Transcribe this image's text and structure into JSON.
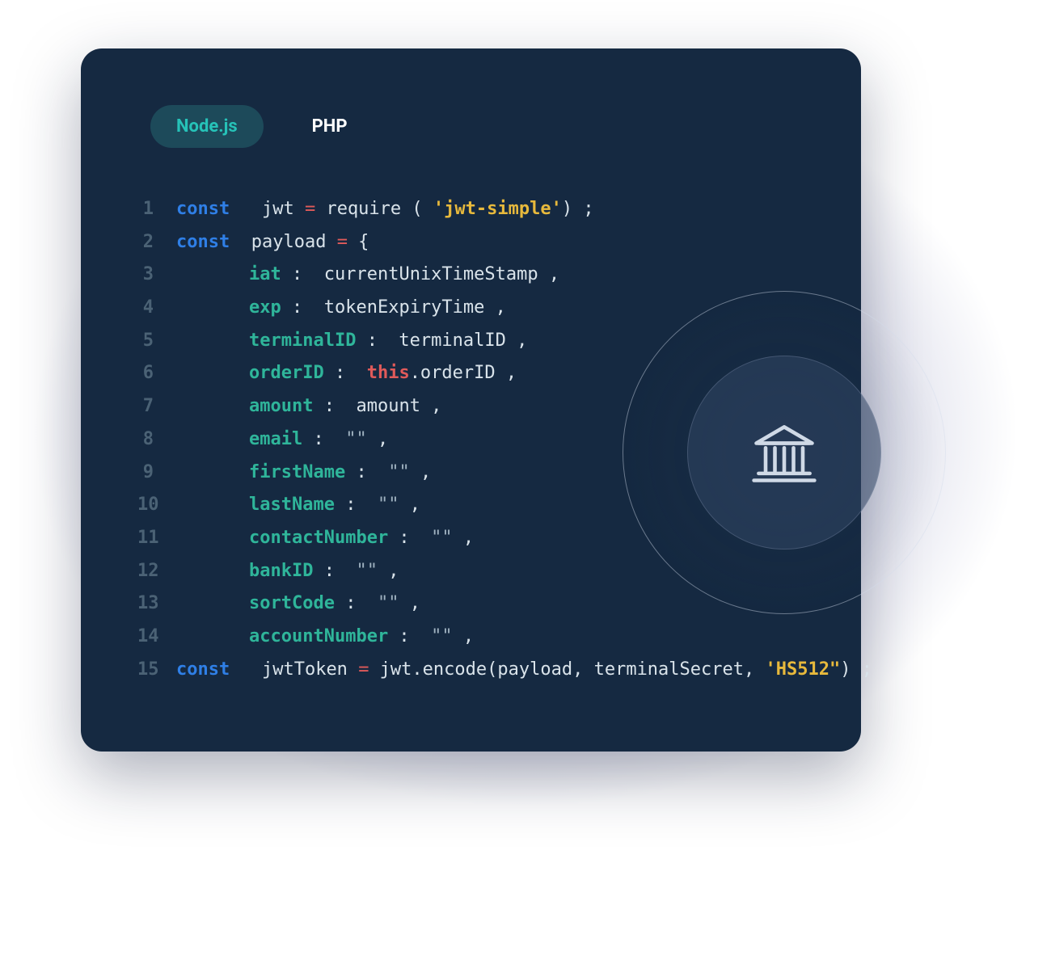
{
  "tabs": {
    "active": "Node.js",
    "other": "PHP"
  },
  "code": {
    "lines": [
      {
        "n": "1",
        "kw": "const",
        "body": [
          [
            "txt",
            "   jwt "
          ],
          [
            "op",
            "="
          ],
          [
            "txt",
            " require ( "
          ],
          [
            "str",
            "'jwt-simple'"
          ],
          [
            "txt",
            ") ;"
          ]
        ]
      },
      {
        "n": "2",
        "kw": "const",
        "body": [
          [
            "txt",
            "  payload "
          ],
          [
            "op",
            "="
          ],
          [
            "txt",
            " {"
          ]
        ]
      },
      {
        "n": "3",
        "kw": "",
        "indent": true,
        "body": [
          [
            "prop",
            "iat"
          ],
          [
            "txt",
            " :  currentUnixTimeStamp ,"
          ]
        ]
      },
      {
        "n": "4",
        "kw": "",
        "indent": true,
        "body": [
          [
            "prop",
            "exp"
          ],
          [
            "txt",
            " :  tokenExpiryTime ,"
          ]
        ]
      },
      {
        "n": "5",
        "kw": "",
        "indent": true,
        "body": [
          [
            "prop",
            "terminalID"
          ],
          [
            "txt",
            " :  terminalID ,"
          ]
        ]
      },
      {
        "n": "6",
        "kw": "",
        "indent": true,
        "body": [
          [
            "prop",
            "orderID"
          ],
          [
            "txt",
            " :  "
          ],
          [
            "this",
            "this"
          ],
          [
            "txt",
            ".orderID ,"
          ]
        ]
      },
      {
        "n": "7",
        "kw": "",
        "indent": true,
        "body": [
          [
            "prop",
            "amount"
          ],
          [
            "txt",
            " :  amount ,"
          ]
        ]
      },
      {
        "n": "8",
        "kw": "",
        "indent": true,
        "body": [
          [
            "prop",
            "email"
          ],
          [
            "txt",
            " :  "
          ],
          [
            "dim",
            "\"\""
          ],
          [
            "txt",
            " ,"
          ]
        ]
      },
      {
        "n": "9",
        "kw": "",
        "indent": true,
        "body": [
          [
            "prop",
            "firstName"
          ],
          [
            "txt",
            " :  "
          ],
          [
            "dim",
            "\"\""
          ],
          [
            "txt",
            " ,"
          ]
        ]
      },
      {
        "n": "10",
        "kw": "",
        "indent": true,
        "body": [
          [
            "prop",
            "lastName"
          ],
          [
            "txt",
            " :  "
          ],
          [
            "dim",
            "\"\""
          ],
          [
            "txt",
            " ,"
          ]
        ]
      },
      {
        "n": "11",
        "kw": "",
        "indent": true,
        "body": [
          [
            "prop",
            "contactNumber"
          ],
          [
            "txt",
            " :  "
          ],
          [
            "dim",
            "\"\""
          ],
          [
            "txt",
            " ,"
          ]
        ]
      },
      {
        "n": "12",
        "kw": "",
        "indent": true,
        "body": [
          [
            "prop",
            "bankID"
          ],
          [
            "txt",
            " :  "
          ],
          [
            "dim",
            "\"\""
          ],
          [
            "txt",
            " ,"
          ]
        ]
      },
      {
        "n": "13",
        "kw": "",
        "indent": true,
        "body": [
          [
            "prop",
            "sortCode"
          ],
          [
            "txt",
            " :  "
          ],
          [
            "dim",
            "\"\""
          ],
          [
            "txt",
            " ,"
          ]
        ]
      },
      {
        "n": "14",
        "kw": "",
        "indent": true,
        "body": [
          [
            "prop",
            "accountNumber"
          ],
          [
            "txt",
            " :  "
          ],
          [
            "dim",
            "\"\""
          ],
          [
            "txt",
            " ,"
          ]
        ]
      },
      {
        "n": "15",
        "kw": "const",
        "body": [
          [
            "txt",
            "   jwtToken "
          ],
          [
            "op",
            "="
          ],
          [
            "txt",
            " jwt.encode(payload, terminalSecret, "
          ],
          [
            "str",
            "'HS512\""
          ],
          [
            "txt",
            ") ;"
          ]
        ]
      }
    ]
  },
  "icon": {
    "name": "bank-icon"
  }
}
